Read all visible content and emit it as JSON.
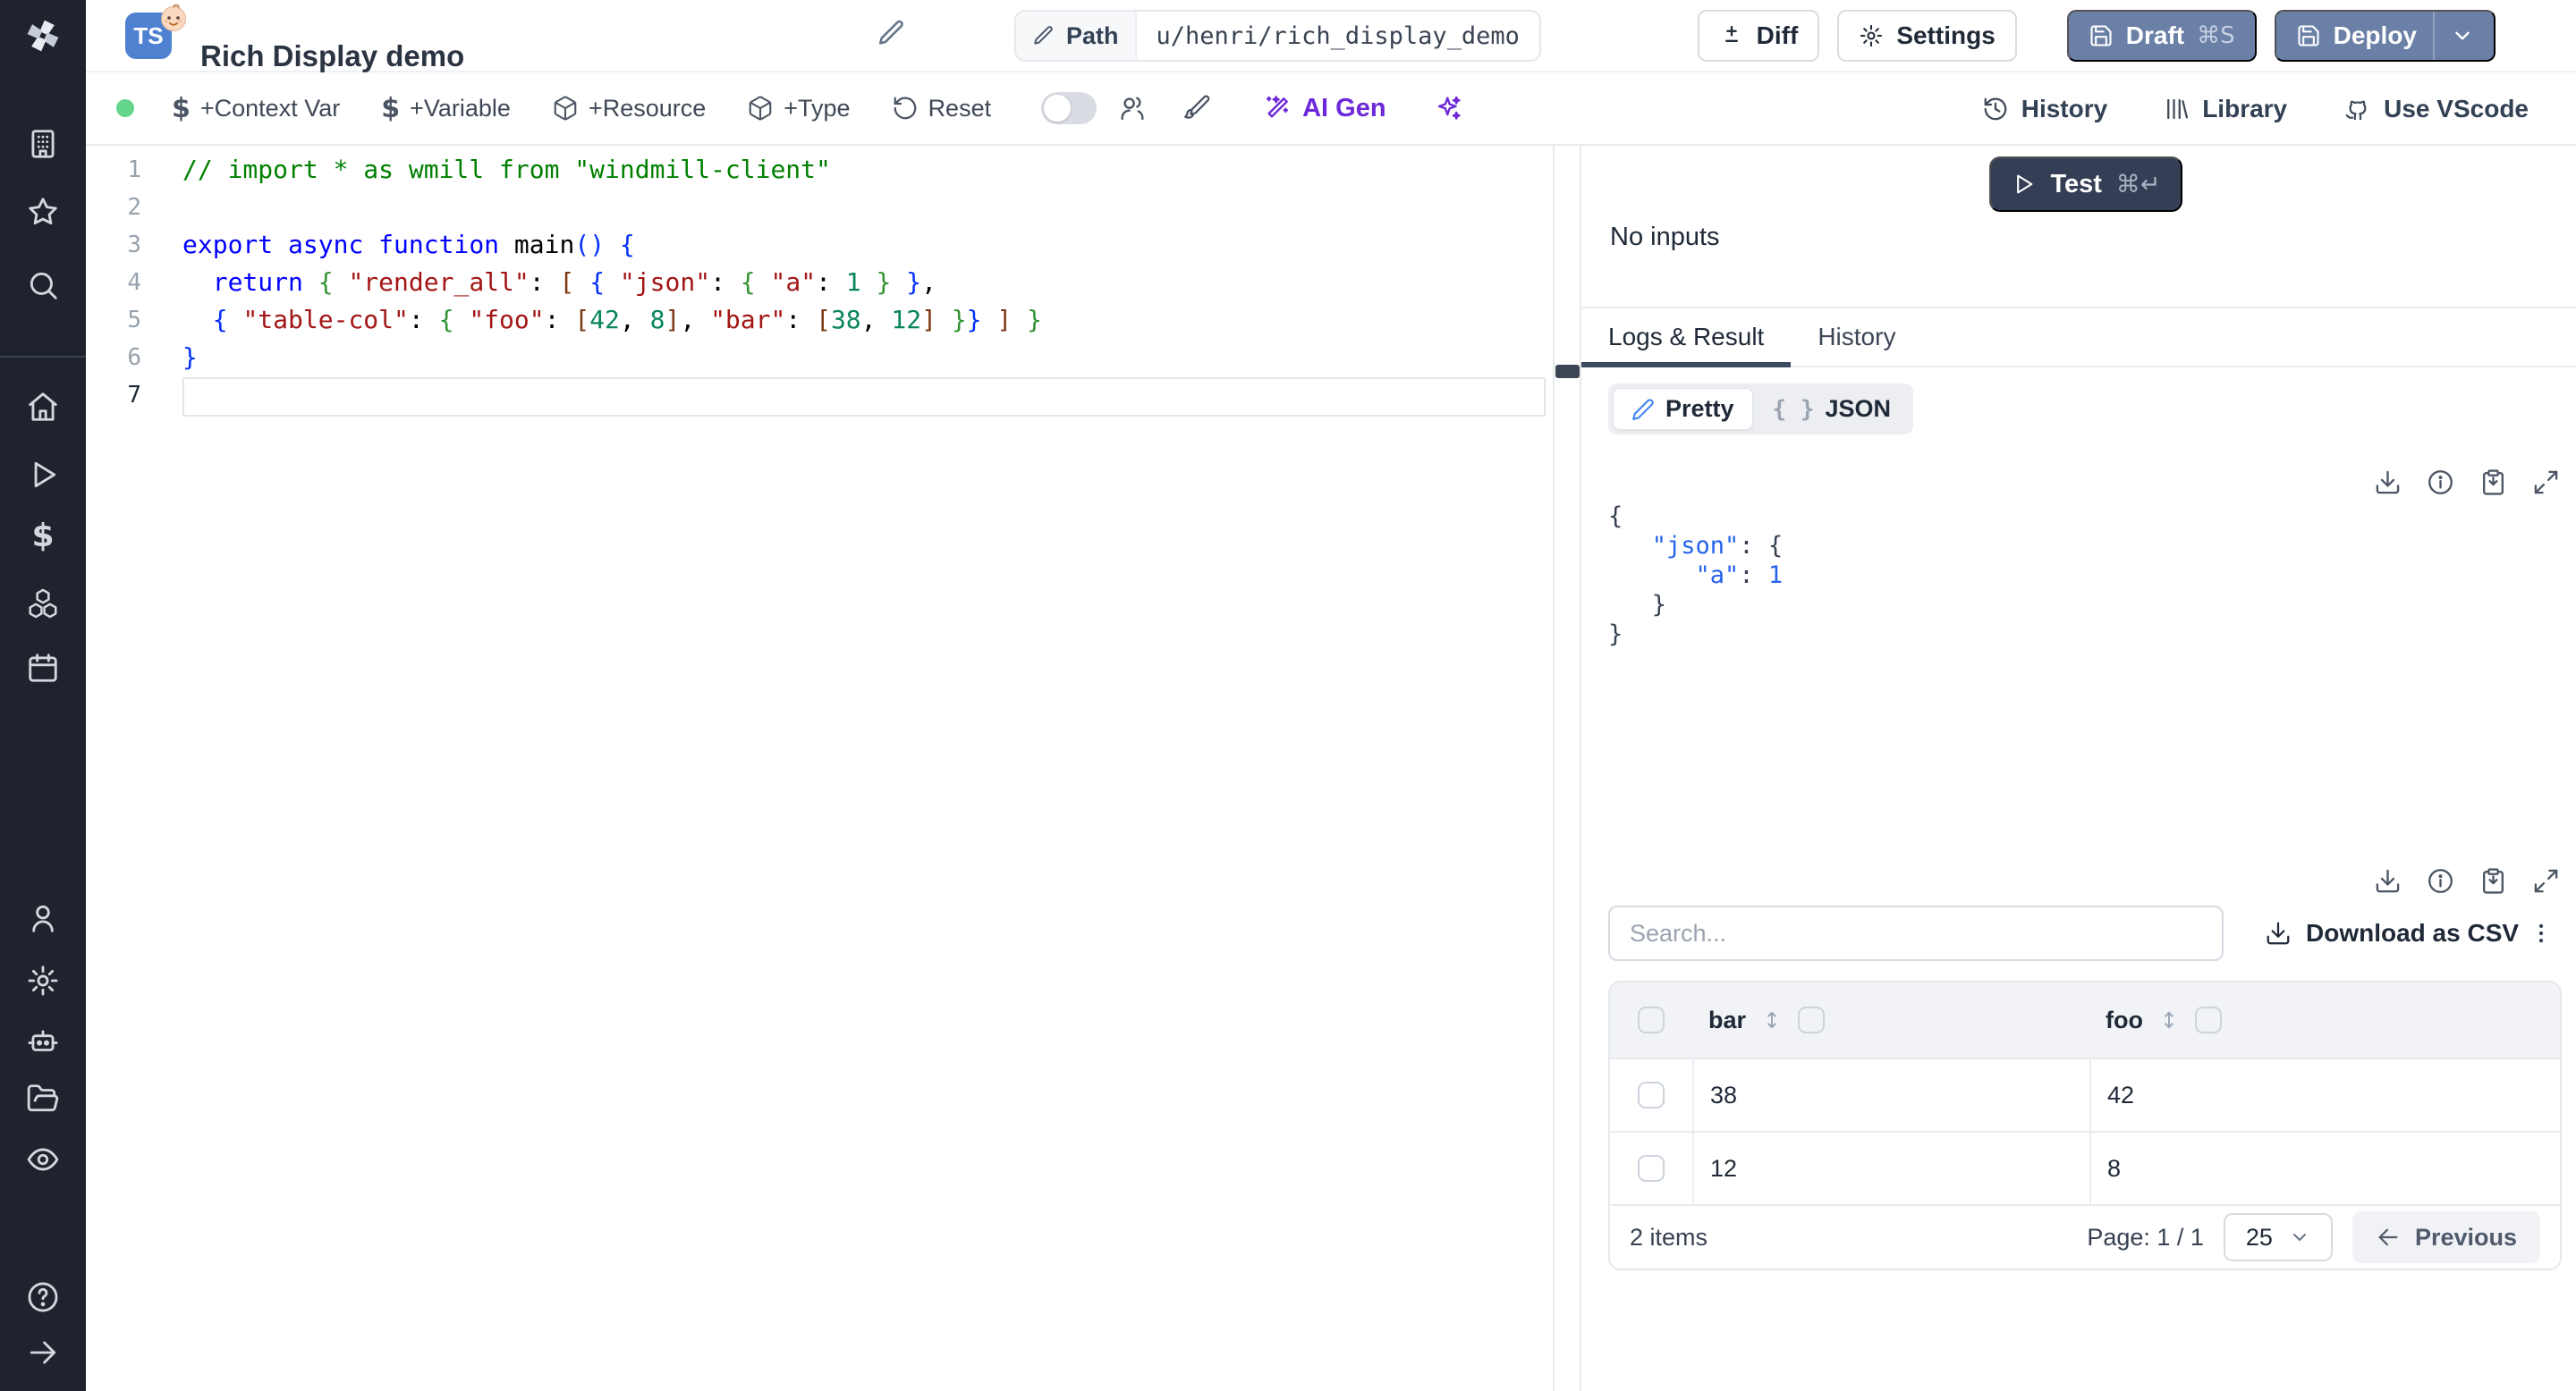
{
  "icons": {
    "dollar": "$",
    "braces": "{ }"
  },
  "sidebar": {
    "icon_names": [
      "windmill-logo",
      "building",
      "star",
      "search",
      "home",
      "play",
      "dollar",
      "boxes",
      "calendar",
      "user",
      "settings",
      "bot",
      "folder-open",
      "eye",
      "help",
      "arrow-right"
    ]
  },
  "header": {
    "badge": "TS",
    "title": "Rich Display demo",
    "path": {
      "label": "Path",
      "value": "u/henri/rich_display_demo"
    },
    "buttons": {
      "diff": "Diff",
      "settings": "Settings",
      "draft": "Draft",
      "draft_shortcut": "⌘S",
      "deploy": "Deploy"
    }
  },
  "toolbar": {
    "left": [
      {
        "icon": "dollar",
        "label": "+Context Var"
      },
      {
        "icon": "dollar",
        "label": "+Variable"
      },
      {
        "icon": "package",
        "label": "+Resource"
      },
      {
        "icon": "package",
        "label": "+Type"
      },
      {
        "icon": "rotate-ccw",
        "label": "Reset"
      }
    ],
    "ai_gen": "AI Gen",
    "right": [
      {
        "icon": "history",
        "label": "History"
      },
      {
        "icon": "library",
        "label": "Library"
      },
      {
        "icon": "github",
        "label": "Use VScode"
      }
    ]
  },
  "editor": {
    "active_line": 7,
    "lines": [
      {
        "n": "1",
        "tokens": [
          [
            "// import * as wmill from \"windmill-client\"",
            "cmt"
          ]
        ]
      },
      {
        "n": "2",
        "tokens": []
      },
      {
        "n": "3",
        "tokens": [
          [
            "export",
            "kw"
          ],
          [
            " ",
            ""
          ],
          [
            "async",
            "kw"
          ],
          [
            " ",
            ""
          ],
          [
            "function",
            "kw"
          ],
          [
            " ",
            ""
          ],
          [
            "main",
            ""
          ],
          [
            "(",
            "b1"
          ],
          [
            ")",
            "b1"
          ],
          [
            " ",
            ""
          ],
          [
            "{",
            "b1"
          ]
        ]
      },
      {
        "n": "4",
        "tokens": [
          [
            "  ",
            ""
          ],
          [
            "return",
            "kw"
          ],
          [
            " ",
            ""
          ],
          [
            "{",
            "b2"
          ],
          [
            " ",
            ""
          ],
          [
            "\"render_all\"",
            "str"
          ],
          [
            ":",
            ""
          ],
          [
            " ",
            ""
          ],
          [
            "[",
            "b3"
          ],
          [
            " ",
            ""
          ],
          [
            "{",
            "b1"
          ],
          [
            " ",
            ""
          ],
          [
            "\"json\"",
            "str"
          ],
          [
            ":",
            ""
          ],
          [
            " ",
            ""
          ],
          [
            "{",
            "b2"
          ],
          [
            " ",
            ""
          ],
          [
            "\"a\"",
            "str"
          ],
          [
            ":",
            ""
          ],
          [
            " ",
            ""
          ],
          [
            "1",
            "num"
          ],
          [
            " ",
            ""
          ],
          [
            "}",
            "b2"
          ],
          [
            " ",
            ""
          ],
          [
            "}",
            "b1"
          ],
          [
            ",",
            ""
          ]
        ]
      },
      {
        "n": "5",
        "tokens": [
          [
            "  ",
            ""
          ],
          [
            "{",
            "b1"
          ],
          [
            " ",
            ""
          ],
          [
            "\"table-col\"",
            "str"
          ],
          [
            ":",
            ""
          ],
          [
            " ",
            ""
          ],
          [
            "{",
            "b2"
          ],
          [
            " ",
            ""
          ],
          [
            "\"foo\"",
            "str"
          ],
          [
            ":",
            ""
          ],
          [
            " ",
            ""
          ],
          [
            "[",
            "b3"
          ],
          [
            "42",
            "num"
          ],
          [
            ",",
            ""
          ],
          [
            " ",
            ""
          ],
          [
            "8",
            "num"
          ],
          [
            "]",
            "b3"
          ],
          [
            ",",
            ""
          ],
          [
            " ",
            ""
          ],
          [
            "\"bar\"",
            "str"
          ],
          [
            ":",
            ""
          ],
          [
            " ",
            ""
          ],
          [
            "[",
            "b3"
          ],
          [
            "38",
            "num"
          ],
          [
            ",",
            ""
          ],
          [
            " ",
            ""
          ],
          [
            "12",
            "num"
          ],
          [
            "]",
            "b3"
          ],
          [
            " ",
            ""
          ],
          [
            "}",
            "b2"
          ],
          [
            "}",
            "b1"
          ],
          [
            " ",
            ""
          ],
          [
            "]",
            "b3"
          ],
          [
            " ",
            ""
          ],
          [
            "}",
            "b2"
          ]
        ]
      },
      {
        "n": "6",
        "tokens": [
          [
            "}",
            "b1"
          ]
        ]
      },
      {
        "n": "7",
        "tokens": []
      }
    ]
  },
  "run_panel": {
    "no_inputs": "No inputs",
    "test": "Test",
    "test_shortcut": "⌘↵",
    "tabs": [
      {
        "label": "Logs & Result",
        "active": true
      },
      {
        "label": "History",
        "active": false
      }
    ],
    "view_toggle": {
      "pretty": "Pretty",
      "json": "JSON"
    },
    "result_lines": [
      [
        [
          "{",
          "jb"
        ]
      ],
      [
        [
          "   ",
          ""
        ],
        [
          "\"json\"",
          "jk"
        ],
        [
          ":",
          "jp"
        ],
        [
          " ",
          ""
        ],
        [
          "{",
          "jb"
        ]
      ],
      [
        [
          "      ",
          ""
        ],
        [
          "\"a\"",
          "jk"
        ],
        [
          ":",
          "jp"
        ],
        [
          " ",
          ""
        ],
        [
          "1",
          "jn"
        ]
      ],
      [
        [
          "   }",
          "jb"
        ]
      ],
      [
        [
          "}",
          "jb"
        ]
      ]
    ]
  },
  "table": {
    "search_placeholder": "Search...",
    "download_csv": "Download as CSV",
    "columns": [
      "bar",
      "foo"
    ],
    "rows": [
      [
        "38",
        "42"
      ],
      [
        "12",
        "8"
      ]
    ],
    "footer": {
      "count": "2 items",
      "page": "Page: 1 / 1",
      "page_size": "25",
      "previous": "Previous"
    }
  },
  "colors": {
    "ts_badge_blue": "#4f81d1",
    "button_slate": "#6b80a7",
    "test_navy": "#343e55",
    "ai_violet": "#6d28d9",
    "status_green": "#63d68c",
    "tab_underline": "#3b4a60"
  }
}
